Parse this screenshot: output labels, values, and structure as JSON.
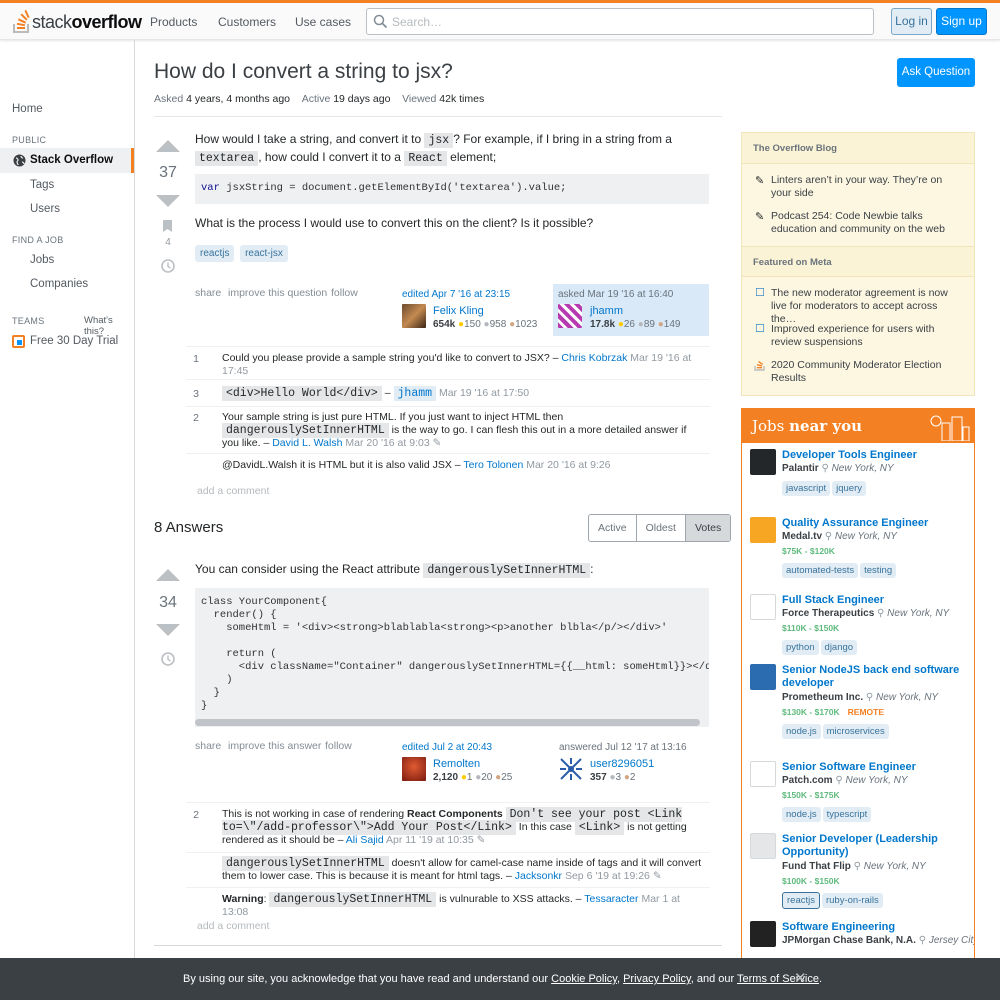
{
  "topbar": {
    "logo_light": "stack",
    "logo_bold": "overflow",
    "nav": [
      "Products",
      "Customers",
      "Use cases"
    ],
    "search_placeholder": "Search…",
    "login": "Log in",
    "signup": "Sign up"
  },
  "leftnav": {
    "home": "Home",
    "public": "PUBLIC",
    "stackoverflow": "Stack Overflow",
    "tags": "Tags",
    "users": "Users",
    "find_job": "FIND A JOB",
    "jobs": "Jobs",
    "companies": "Companies",
    "teams": "TEAMS",
    "whats_this": "What's this?",
    "trial": "Free 30 Day Trial"
  },
  "question": {
    "title": "How do I convert a string to jsx?",
    "ask_button": "Ask Question",
    "asked_label": "Asked",
    "asked": "4 years, 4 months ago",
    "active_label": "Active",
    "active": "19 days ago",
    "viewed_label": "Viewed",
    "viewed": "42k times",
    "votes": "37",
    "bookmarks": "4",
    "p1a": "How would I take a string, and convert it to",
    "p1code": "jsx",
    "p1b": "? For example, if I bring in a string from a",
    "p1code2": "textarea",
    "p1c": ", how could I convert it to a",
    "p1code3": "React",
    "p1d": "element;",
    "code": "var jsxString = document.getElementById('textarea').value;",
    "p2": "What is the process I would use to convert this on the client? Is it possible?",
    "tags": [
      "reactjs",
      "react-jsx"
    ],
    "menu": [
      "share",
      "improve this question",
      "follow"
    ],
    "edited": "edited Apr 7 '16 at 23:15",
    "editor": "Felix Kling",
    "editor_rep": "654k",
    "editor_badges": [
      "150",
      "958",
      "1023"
    ],
    "asked_sig": "asked Mar 19 '16 at 16:40",
    "asker": "jhamm",
    "asker_rep": "17.8k",
    "asker_badges": [
      "26",
      "89",
      "149"
    ]
  },
  "qcomments": [
    {
      "score": "1",
      "text": "Could you please provide a sample string you'd like to convert to JSX? –",
      "user": "Chris Kobrzak",
      "date": "Mar 19 '16 at 17:45"
    },
    {
      "score": "3",
      "code": "<div>Hello World</div>",
      "dash": "–",
      "user": "jhamm",
      "date": "Mar 19 '16 at 17:50"
    },
    {
      "score": "2",
      "text1": "Your sample string is just pure HTML. If you just want to inject HTML then",
      "code": "dangerouslySetInnerHTML",
      "text2": "is the way to go. I can flesh this out in a more detailed answer if you like.",
      "dash": "–",
      "user": "David L. Walsh",
      "date": "Mar 20 '16 at 9:03"
    },
    {
      "score": "",
      "text": "@DavidL.Walsh it is HTML but it is also valid JSX –",
      "user": "Tero Tolonen",
      "date": "Mar 20 '16 at 9:26"
    }
  ],
  "add_comment": "add a comment",
  "answers": {
    "header": "8 Answers",
    "sort": [
      "Active",
      "Oldest",
      "Votes"
    ]
  },
  "answer": {
    "votes": "34",
    "text": "You can consider using the React attribute",
    "code_inline": "dangerouslySetInnerHTML",
    "colon": ":",
    "code_lines": [
      "class YourComponent{",
      "  render() {",
      "    someHtml = '<div><strong>blablabla<strong><p>another blbla</p/></div>'",
      "",
      "    return (",
      "      <div className=\"Container\" dangerouslySetInnerHTML={{__html: someHtml}}></div>",
      "    )",
      "  }",
      "}"
    ],
    "menu": [
      "share",
      "improve this answer",
      "follow"
    ],
    "edited": "edited Jul 2 at 20:43",
    "editor": "Remolten",
    "editor_rep": "2,120",
    "editor_badges": [
      "1",
      "20",
      "25"
    ],
    "answered": "answered Jul 12 '17 at 13:16",
    "author": "user8296051",
    "author_rep": "357",
    "author_badges": [
      "3",
      "2"
    ]
  },
  "acomments": [
    {
      "score": "2",
      "t1": "This is not working in case of rendering",
      "bold": "React Components",
      "code1": "Don't see your post <Link to=\\\"/add-professor\\\">Add Your Post</Link>",
      "t2": "In this case",
      "code2": "<Link>",
      "t3": "is not getting rendered as it should be –",
      "user": "Ali Sajid",
      "date": "Apr 11 '19 at 10:35"
    },
    {
      "score": "",
      "code": "dangerouslySetInnerHTML",
      "t1": "doesn't allow for camel-case name inside of tags and it will convert them to lower case. This is because it is meant for html tags. –",
      "user": "Jacksonkr",
      "date": "Sep 6 '19 at 19:26"
    },
    {
      "score": "",
      "bold": "Warning",
      "t0": ":",
      "code": "dangerouslySetInnerHTML",
      "t1": "is vulnurable to XSS attacks. –",
      "user": "Tessaracter",
      "date": "Mar 1 at 13:08"
    }
  ],
  "blog": {
    "header1": "The Overflow Blog",
    "items1": [
      "Linters aren’t in your way. They’re on your side",
      "Podcast 254: Code Newbie talks education and community on the web"
    ],
    "header2": "Featured on Meta",
    "items2": [
      "The new moderator agreement is now live for moderators to accept across the…",
      "Improved experience for users with review suspensions",
      "2020 Community Moderator Election Results"
    ]
  },
  "jobs": {
    "header_a": "Jobs",
    "header_b": "near you",
    "items": [
      {
        "title": "Developer Tools Engineer",
        "company": "Palantir",
        "loc": "New York, NY",
        "salary": "",
        "tags": [
          "javascript",
          "jquery"
        ]
      },
      {
        "title": "Quality Assurance Engineer",
        "company": "Medal.tv",
        "loc": "New York, NY",
        "salary": "$75K - $120K",
        "tags": [
          "automated-tests",
          "testing"
        ]
      },
      {
        "title": "Full Stack Engineer",
        "company": "Force Therapeutics",
        "loc": "New York, NY",
        "salary": "$110K - $150K",
        "tags": [
          "python",
          "django"
        ]
      },
      {
        "title": "Senior NodeJS back end software developer",
        "company": "Prometheum Inc.",
        "loc": "New York, NY",
        "salary": "$130K - $170K",
        "remote": "REMOTE",
        "tags": [
          "node.js",
          "microservices"
        ]
      },
      {
        "title": "Senior Software Engineer",
        "company": "Patch.com",
        "loc": "New York, NY",
        "salary": "$150K - $175K",
        "tags": [
          "node.js",
          "typescript"
        ]
      },
      {
        "title": "Senior Developer (Leadership Opportunity)",
        "company": "Fund That Flip",
        "loc": "New York, NY",
        "salary": "$100K - $150K",
        "tags": [
          "reactjs",
          "ruby-on-rails"
        ]
      },
      {
        "title": "Software Engineering",
        "company": "JPMorgan Chase Bank, N.A.",
        "loc": "Jersey City, NJ",
        "salary": "",
        "tags": []
      }
    ]
  },
  "cookie": {
    "t1": "By using our site, you acknowledge that you have read and understand our",
    "l1": "Cookie Policy",
    "t2": ",",
    "l2": "Privacy Policy",
    "t3": ", and our",
    "l3": "Terms of Service",
    "t4": "."
  }
}
